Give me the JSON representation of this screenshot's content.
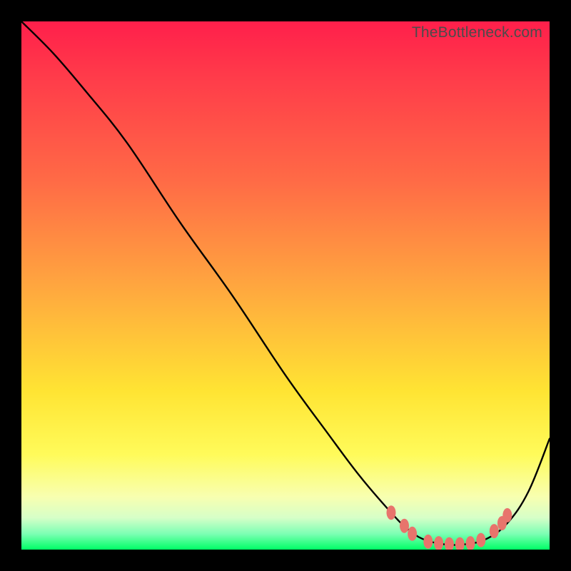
{
  "watermark": "TheBottleneck.com",
  "chart_data": {
    "type": "line",
    "title": "",
    "xlabel": "",
    "ylabel": "",
    "xlim": [
      0,
      100
    ],
    "ylim": [
      0,
      100
    ],
    "series": [
      {
        "name": "bottleneck-curve",
        "x": [
          0,
          6,
          12,
          20,
          30,
          40,
          50,
          58,
          64,
          70,
          73,
          76,
          80,
          84,
          88,
          92,
          96,
          100
        ],
        "y": [
          100,
          94,
          87,
          77,
          62,
          48,
          33,
          22,
          14,
          7,
          4,
          2,
          1,
          1,
          2,
          5,
          11,
          21
        ]
      }
    ],
    "markers": {
      "name": "highlighted-points",
      "color": "#e8746c",
      "points": [
        {
          "x": 70.0,
          "y": 7.0
        },
        {
          "x": 72.5,
          "y": 4.5
        },
        {
          "x": 74.0,
          "y": 3.0
        },
        {
          "x": 77.0,
          "y": 1.5
        },
        {
          "x": 79.0,
          "y": 1.2
        },
        {
          "x": 81.0,
          "y": 1.0
        },
        {
          "x": 83.0,
          "y": 1.0
        },
        {
          "x": 85.0,
          "y": 1.2
        },
        {
          "x": 87.0,
          "y": 1.8
        },
        {
          "x": 89.5,
          "y": 3.5
        },
        {
          "x": 91.0,
          "y": 5.0
        },
        {
          "x": 92.0,
          "y": 6.5
        }
      ]
    }
  }
}
